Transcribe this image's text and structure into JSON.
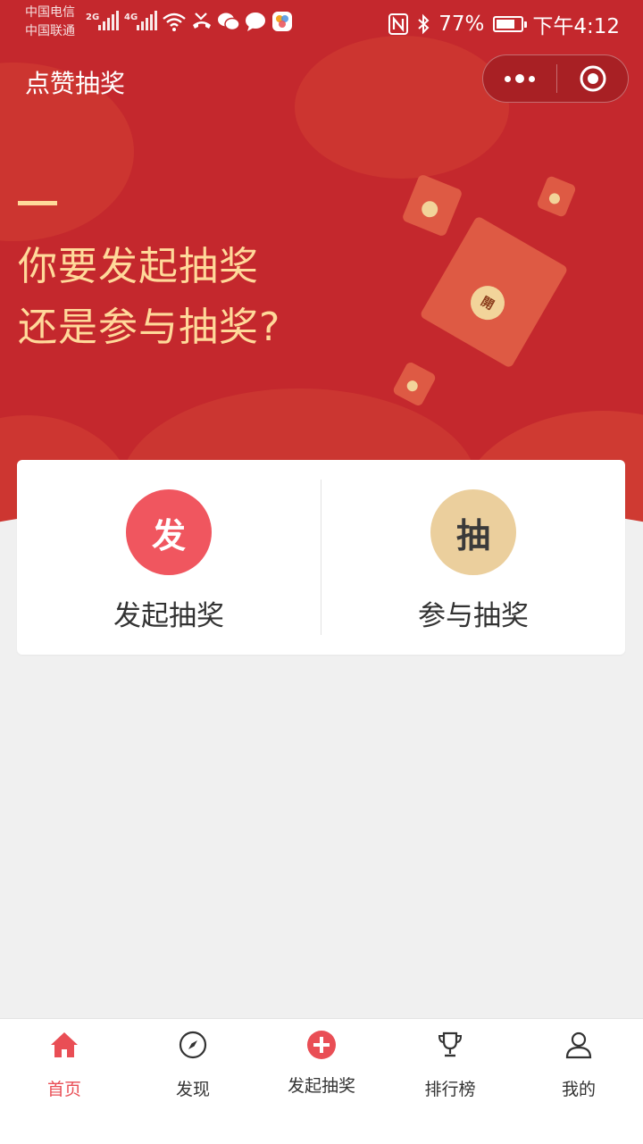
{
  "status_bar": {
    "carrier1": "中国电信",
    "carrier2": "中国联通",
    "net1": "2G",
    "net2": "4G",
    "battery": "77%",
    "battery_level": 0.77,
    "time": "下午4:12"
  },
  "nav": {
    "title": "点赞抽奖"
  },
  "hero": {
    "line1": "你要发起抽奖",
    "line2": "还是参与抽奖?",
    "envelope_seal": "開"
  },
  "options": [
    {
      "icon_char": "发",
      "label": "发起抽奖"
    },
    {
      "icon_char": "抽",
      "label": "参与抽奖"
    }
  ],
  "tabs": [
    {
      "label": "首页",
      "icon": "home-icon",
      "active": true
    },
    {
      "label": "发现",
      "icon": "compass-icon",
      "active": false
    },
    {
      "label": "发起抽奖",
      "icon": "plus-circle-icon",
      "active": false
    },
    {
      "label": "排行榜",
      "icon": "trophy-icon",
      "active": false
    },
    {
      "label": "我的",
      "icon": "user-icon",
      "active": false
    }
  ],
  "colors": {
    "brand_red": "#c4282d",
    "accent_gold": "#ffd99a",
    "active_tab": "#e94e55"
  }
}
